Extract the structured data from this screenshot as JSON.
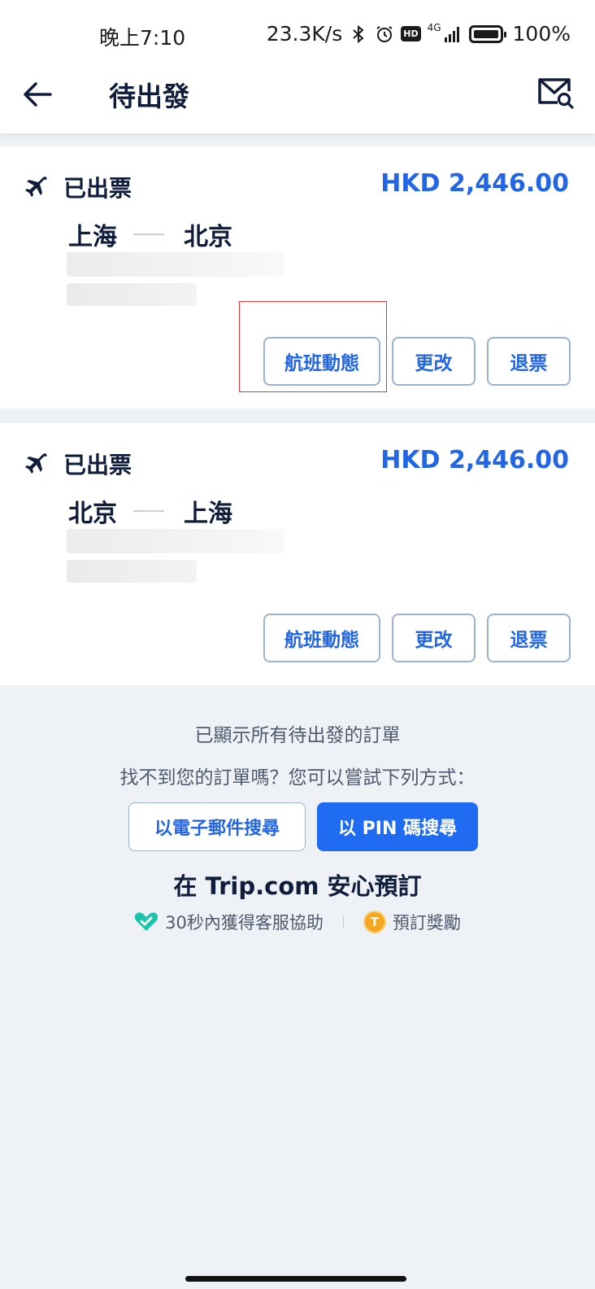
{
  "status_bar": {
    "time": "晚上7:10",
    "net_speed": "23.3K/s",
    "hd_badge": "HD",
    "network_type": "4G",
    "battery_percent": "100%"
  },
  "header": {
    "title": "待出發"
  },
  "orders": [
    {
      "status": "已出票",
      "price": "HKD 2,446.00",
      "from": "上海",
      "to": "北京",
      "actions": {
        "flight_status": "航班動態",
        "change": "更改",
        "refund": "退票"
      }
    },
    {
      "status": "已出票",
      "price": "HKD 2,446.00",
      "from": "北京",
      "to": "上海",
      "actions": {
        "flight_status": "航班動態",
        "change": "更改",
        "refund": "退票"
      }
    }
  ],
  "footer": {
    "all_shown": "已顯示所有待出發的訂單",
    "cant_find": "找不到您的訂單嗎？您可以嘗試下列方式：",
    "search_email": "以電子郵件搜尋",
    "search_pin": "以 PIN 碼搜尋",
    "book_safe": "在 Trip.com 安心預訂",
    "perk_service": "30秒內獲得客服協助",
    "perk_rewards": "預訂獎勵",
    "coin_letter": "T"
  },
  "colors": {
    "accent": "#2266e6",
    "primary_button": "#1f6cf2",
    "text_dark": "#0f1d3a",
    "highlight_box": "#e03a3a"
  }
}
